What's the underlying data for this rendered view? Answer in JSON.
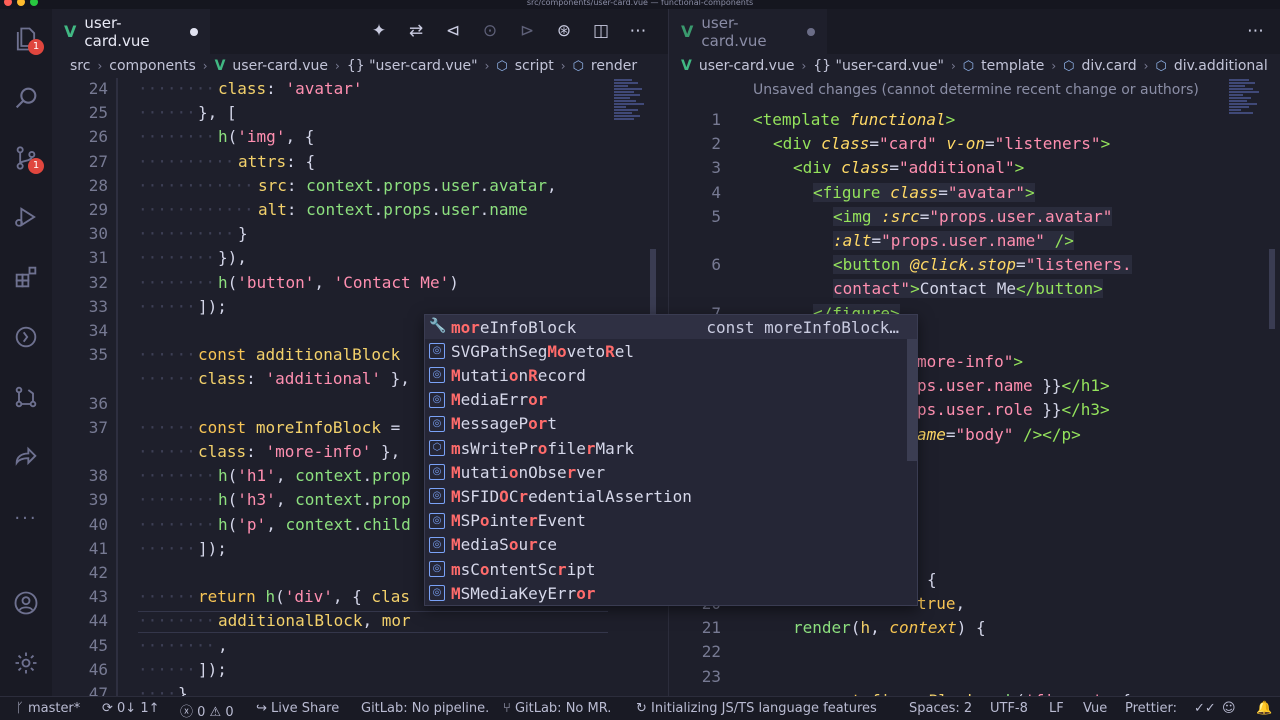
{
  "window": {
    "title": "src/components/user-card.vue — functional-components"
  },
  "activity_bar": {
    "explorer_badge": "1",
    "scm_badge": "1",
    "more": "···"
  },
  "left_editor": {
    "tab": {
      "label": "user-card.vue"
    },
    "breadcrumb": [
      "src",
      "components",
      "user-card.vue",
      "{} \"user-card.vue\"",
      "script",
      "render"
    ],
    "lines": [
      {
        "n": "24",
        "indent": 4,
        "html_key": 0
      },
      {
        "n": "25",
        "indent": 3
      },
      {
        "n": "26",
        "indent": 4
      },
      {
        "n": "27",
        "indent": 5
      },
      {
        "n": "28",
        "indent": 6
      },
      {
        "n": "29",
        "indent": 6
      },
      {
        "n": "30",
        "indent": 5
      },
      {
        "n": "31",
        "indent": 4
      },
      {
        "n": "32",
        "indent": 4
      },
      {
        "n": "33",
        "indent": 3
      },
      {
        "n": "34",
        "indent": 0
      },
      {
        "n": "35",
        "indent": 3
      },
      {
        "n": "",
        "indent": 3
      },
      {
        "n": "36",
        "indent": 0
      },
      {
        "n": "37",
        "indent": 3
      },
      {
        "n": "",
        "indent": 3
      },
      {
        "n": "38",
        "indent": 4
      },
      {
        "n": "39",
        "indent": 4
      },
      {
        "n": "40",
        "indent": 4
      },
      {
        "n": "41",
        "indent": 3
      },
      {
        "n": "42",
        "indent": 0
      },
      {
        "n": "43",
        "indent": 3
      },
      {
        "n": "44",
        "indent": 4
      },
      {
        "n": "45",
        "indent": 4
      },
      {
        "n": "46",
        "indent": 3
      },
      {
        "n": "47",
        "indent": 2
      }
    ]
  },
  "right_editor": {
    "tab": {
      "label": "user-card.vue"
    },
    "breadcrumb": [
      "user-card.vue",
      "{} \"user-card.vue\"",
      "template",
      "div.card",
      "div.additional"
    ],
    "blame": "Unsaved changes (cannot determine recent change or authors)",
    "line_numbers": [
      "1",
      "2",
      "3",
      "4",
      "5",
      "",
      "6",
      "",
      "7",
      "",
      "",
      "",
      "",
      "",
      "",
      "",
      "",
      "",
      "",
      "",
      "20",
      "21",
      "22",
      "23"
    ]
  },
  "suggest": {
    "items": [
      {
        "pre": "",
        "m": "mor",
        "rest": "eInfoBlock",
        "detail": "const moreInfoBlock…",
        "icon": "wrench-icon"
      },
      {
        "label": "SVGPathSegMovetoRel",
        "icon": "interface-icon"
      },
      {
        "label": "MutationRecord",
        "icon": "interface-icon"
      },
      {
        "label": "MediaError",
        "icon": "interface-icon"
      },
      {
        "label": "MessagePort",
        "icon": "interface-icon"
      },
      {
        "label": "msWriteProfilerMark",
        "icon": "method-icon"
      },
      {
        "label": "MutationObserver",
        "icon": "interface-icon"
      },
      {
        "label": "MSFIDOCredentialAssertion",
        "icon": "interface-icon"
      },
      {
        "label": "MSPointerEvent",
        "icon": "interface-icon"
      },
      {
        "label": "MediaSource",
        "icon": "interface-icon"
      },
      {
        "label": "msContentScript",
        "icon": "interface-icon"
      },
      {
        "label": "MSMediaKeyError",
        "icon": "interface-icon"
      }
    ]
  },
  "status_bar": {
    "branch": "master*",
    "sync": "0↓ 1↑",
    "problems_errors": "0",
    "problems_warnings": "0",
    "live_share": "Live Share",
    "gitlab_pipeline": "GitLab: No pipeline.",
    "gitlab_mr": "GitLab: No MR.",
    "ts_status": "Initializing JS/TS language features",
    "spaces": "Spaces: 2",
    "encoding": "UTF-8",
    "eol": "LF",
    "language": "Vue",
    "prettier": "Prettier:"
  }
}
